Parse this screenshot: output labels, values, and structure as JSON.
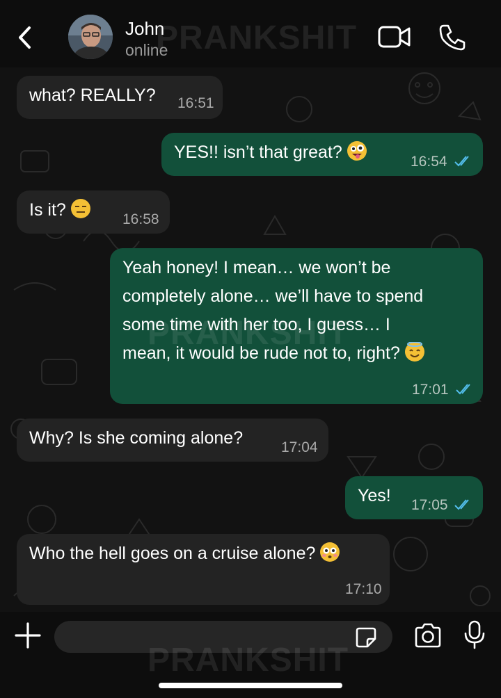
{
  "header": {
    "contact_name": "John",
    "status": "online"
  },
  "watermark": "PRANKSHIT",
  "messages": [
    {
      "dir": "in",
      "text": "what? REALLY?",
      "time": "16:51"
    },
    {
      "dir": "out",
      "text": "YES!! isn’t that great?",
      "emoji": "zany-face",
      "time": "16:54",
      "read": true
    },
    {
      "dir": "in",
      "text": "Is it?",
      "emoji": "expressionless-face",
      "time": "16:58"
    },
    {
      "dir": "out",
      "lines": [
        "Yeah honey! I mean… we won’t be",
        "completely alone… we’ll have to spend",
        "some time with her too, I guess… I",
        "mean, it would be rude not to, right?"
      ],
      "emoji": "smiling-face-with-halo",
      "time": "17:01",
      "read": true
    },
    {
      "dir": "in",
      "text": "Why? Is she coming alone?",
      "time": "17:04"
    },
    {
      "dir": "out",
      "text": "Yes!",
      "time": "17:05",
      "read": true
    },
    {
      "dir": "in",
      "text": "Who the hell goes on a cruise alone?",
      "emoji": "flushed-face",
      "time": "17:10"
    }
  ],
  "composer": {
    "placeholder": ""
  },
  "colors": {
    "incoming_bubble": "#232323",
    "outgoing_bubble": "#12503a",
    "read_ticks": "#53bdeb",
    "background": "#121212"
  }
}
